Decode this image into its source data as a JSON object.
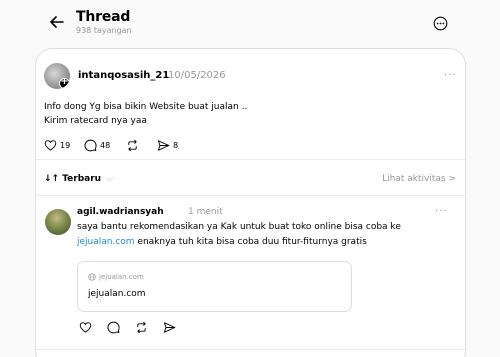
{
  "header": {
    "title": "Thread",
    "views": "938 tayangan",
    "back_icon": "arrow-left-icon",
    "more_icon": "more-circle-icon"
  },
  "post": {
    "username": "intanqosasih_21",
    "date": "10/05/2026",
    "more": "···",
    "text_line1": "Info dong Yg bisa bikin Website buat jualan ..",
    "text_line2": "Kirim ratecard nya yaa",
    "likes": "19",
    "comments": "48",
    "shares": "8"
  },
  "sort": {
    "label": "Terbaru",
    "chevron": "⌵",
    "activity": "Lihat aktivitas",
    "activity_chevron": ">"
  },
  "reply": {
    "username": "agil.wadriansyah",
    "time": "1 menit",
    "more": "···",
    "text_part1": "saya bantu rekomendasikan ya Kak untuk buat toko online bisa coba ke",
    "link": "jejualan.com",
    "text_part2": " enaknya tuh kita bisa coba duu fitur-fiturnya gratis",
    "card_domain": "jejualan.com",
    "card_title": "jejualan.com"
  },
  "colors": {
    "link": "#1d8bd8",
    "muted": "#999999",
    "border": "#dedede"
  }
}
